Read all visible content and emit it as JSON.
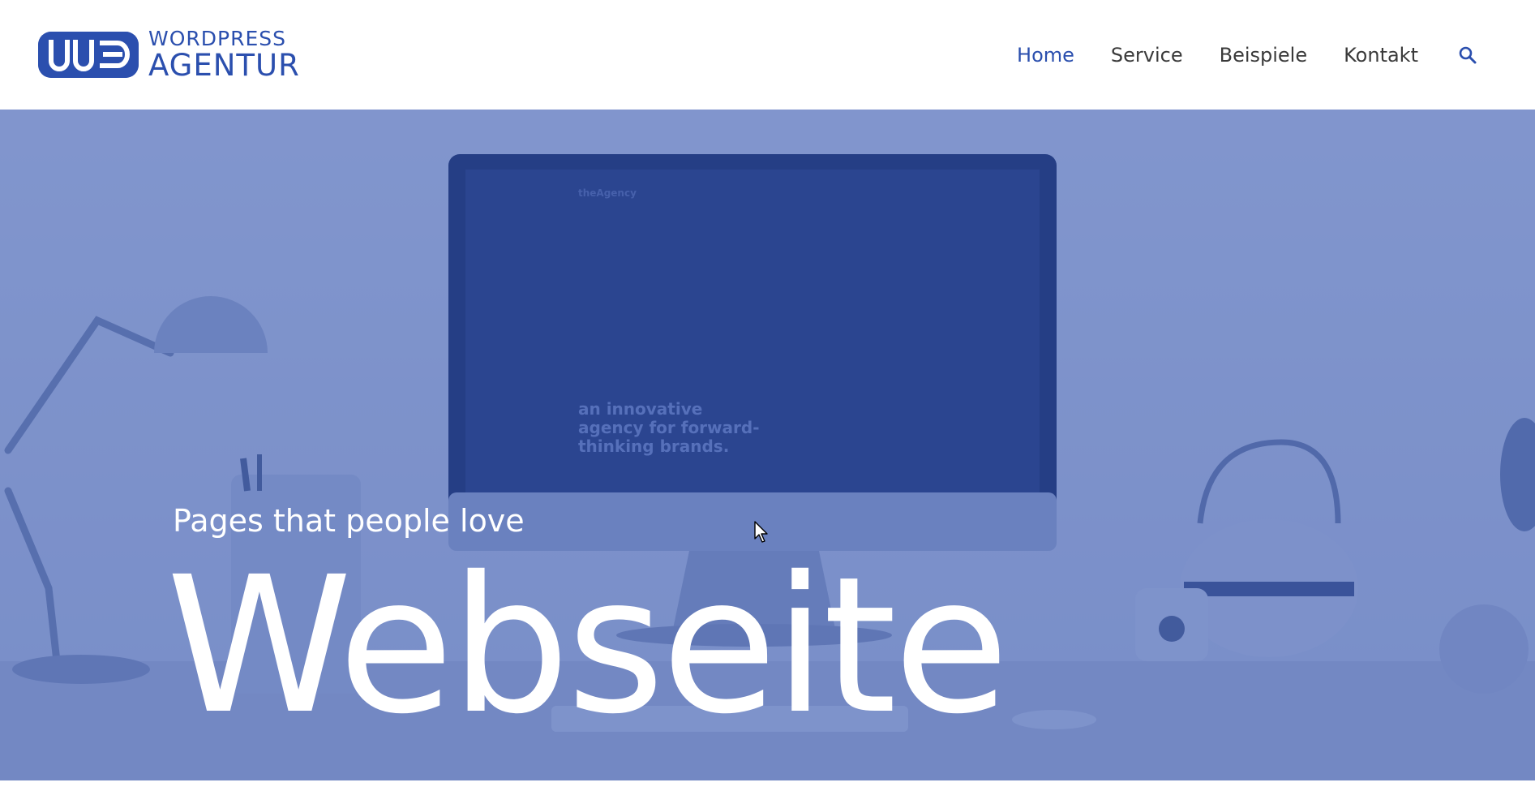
{
  "brand": {
    "logo_line1": "WORDPRESS",
    "logo_line2": "AGENTUR",
    "color": "#2b4fae"
  },
  "nav": {
    "items": [
      {
        "label": "Home",
        "active": true
      },
      {
        "label": "Service",
        "active": false
      },
      {
        "label": "Beispiele",
        "active": false
      },
      {
        "label": "Kontakt",
        "active": false
      }
    ],
    "search_icon": "search-icon"
  },
  "hero": {
    "monitor_logo": "theAgency",
    "monitor_text": "an innovative agency for forward-thinking brands.",
    "tagline": "Pages that people love",
    "headline": "Webseite",
    "overlay_color": "#2b4fae"
  }
}
